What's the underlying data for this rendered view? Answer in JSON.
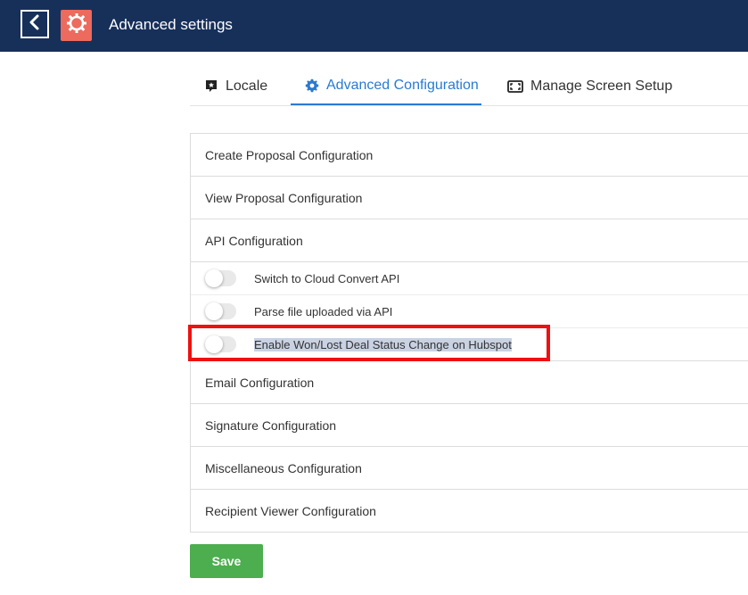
{
  "header": {
    "title": "Advanced settings",
    "back_icon": "chevron-left-icon",
    "app_icon": "gear-icon",
    "background_color": "#17305a",
    "app_icon_color": "#ec6a5e"
  },
  "tabs": [
    {
      "label": "Locale",
      "icon": "locale-icon",
      "active": false
    },
    {
      "label": "Advanced Configuration",
      "icon": "gear-icon",
      "active": true
    },
    {
      "label": "Manage Screen Setup",
      "icon": "screen-icon",
      "active": false
    }
  ],
  "accent_color": "#2a7ad2",
  "sections": {
    "create_proposal": "Create Proposal Configuration",
    "view_proposal": "View Proposal Configuration",
    "api": {
      "label": "API Configuration",
      "toggles": [
        {
          "label": "Switch to Cloud Convert API",
          "enabled": false
        },
        {
          "label": "Parse file uploaded via API",
          "enabled": false
        },
        {
          "label": "Enable Won/Lost Deal Status Change on Hubspot",
          "enabled": false,
          "highlighted": true
        }
      ]
    },
    "email": "Email Configuration",
    "signature": "Signature Configuration",
    "misc": "Miscellaneous Configuration",
    "recipient_viewer": "Recipient Viewer Configuration"
  },
  "save_label": "Save",
  "save_color": "#4cae4f",
  "annotation_color": "#ee1111"
}
